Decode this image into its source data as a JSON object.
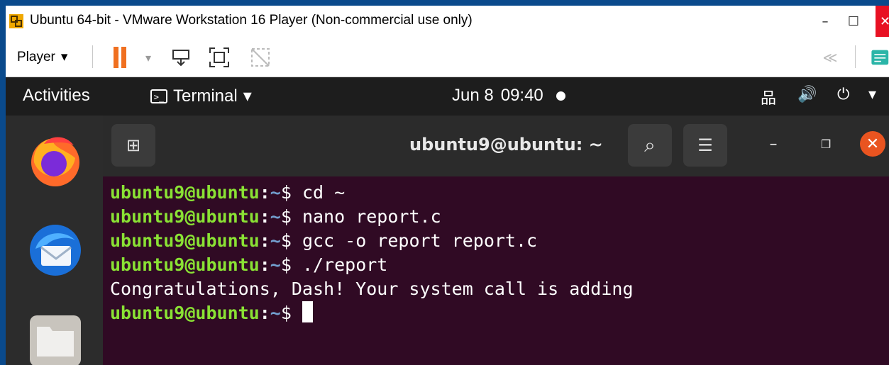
{
  "vmware": {
    "title": "Ubuntu 64-bit - VMware Workstation 16 Player (Non-commercial use only)",
    "window_controls": {
      "minimize": "–",
      "maximize": "☐",
      "close": "✕"
    },
    "toolbar": {
      "player_label": "Player",
      "dropdown_glyph": "▾",
      "back_glyph": "≪"
    },
    "colors": {
      "pause": "#f07020",
      "close": "#e81123"
    }
  },
  "ubuntu": {
    "topbar": {
      "activities": "Activities",
      "app_menu": "Terminal",
      "app_menu_glyph": "▾",
      "date": "Jun 8",
      "time": "09:40",
      "tray_icons": [
        "network-icon",
        "volume-icon",
        "power-icon"
      ],
      "tray_glyphs": {
        "network": "品",
        "volume": "🔊",
        "power": "⏻",
        "arrow": "▾"
      }
    },
    "dock": {
      "apps": [
        "firefox-icon",
        "thunderbird-icon",
        "files-icon"
      ]
    },
    "terminal": {
      "title": "ubuntu9@ubuntu: ~",
      "header_glyphs": {
        "new_tab": "⊞",
        "search": "⌕",
        "menu": "☰",
        "minimize": "–",
        "maximize": "❐",
        "close": "✕"
      },
      "prompt_user": "ubuntu9@ubuntu",
      "prompt_sep": ":",
      "prompt_path": "~",
      "prompt_symbol": "$",
      "lines": [
        {
          "type": "cmd",
          "text": "cd ~"
        },
        {
          "type": "cmd",
          "text": "nano report.c"
        },
        {
          "type": "cmd",
          "text": "gcc -o report report.c"
        },
        {
          "type": "cmd",
          "text": "./report"
        },
        {
          "type": "out",
          "text": "Congratulations, Dash! Your system call is adding"
        },
        {
          "type": "prompt",
          "text": ""
        }
      ],
      "colors": {
        "background": "#300a24",
        "user": "#8ae234",
        "path": "#729fcf",
        "close": "#e95420"
      }
    }
  }
}
